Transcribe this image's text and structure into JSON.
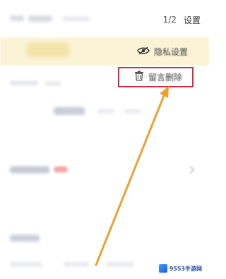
{
  "topbar": {
    "page_indicator": "1/2",
    "settings_label": "设置"
  },
  "menu": {
    "privacy": {
      "label": "隐私设置",
      "icon": "eye-icon"
    },
    "delete": {
      "label": "留言删除",
      "icon": "trash-icon"
    }
  },
  "annotation": {
    "highlight_color": "#d62b3f",
    "arrow_color": "#f0a030"
  },
  "watermark": {
    "text": "9553手游网"
  }
}
